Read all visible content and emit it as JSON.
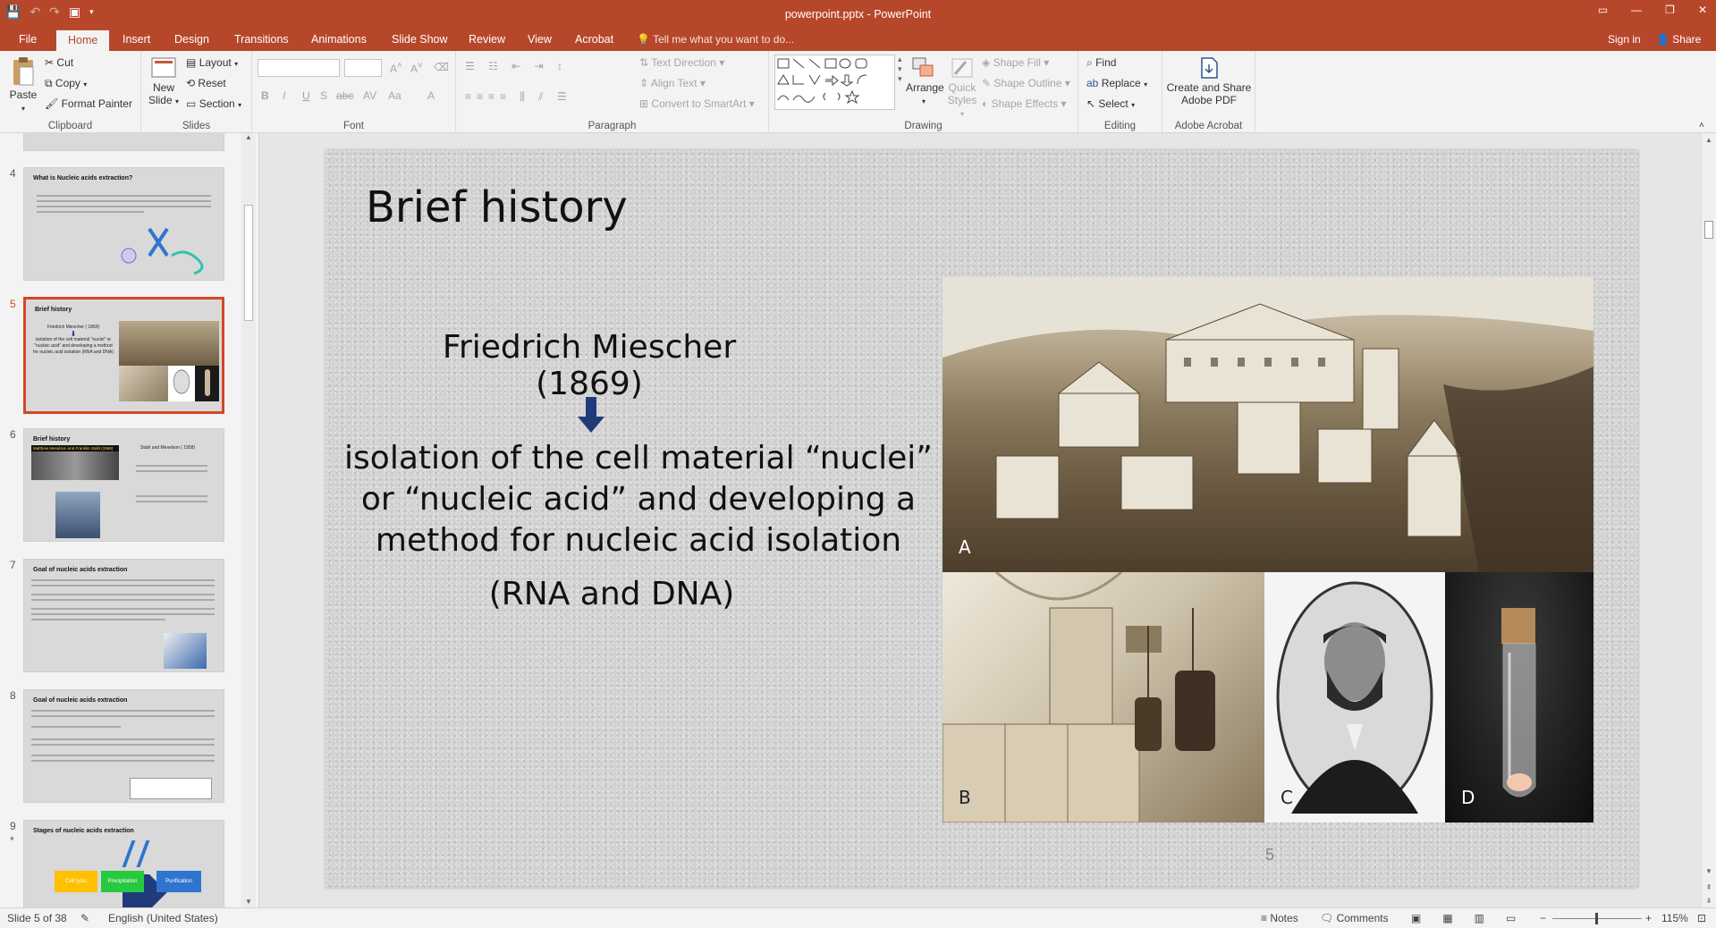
{
  "window": {
    "title": "powerpoint.pptx - PowerPoint",
    "controls": [
      "▭",
      "—",
      "❐",
      "✕"
    ]
  },
  "tabs": [
    "File",
    "Home",
    "Insert",
    "Design",
    "Transitions",
    "Animations",
    "Slide Show",
    "Review",
    "View",
    "Acrobat"
  ],
  "active_tab": "Home",
  "tell_me": "Tell me what you want to do...",
  "account": {
    "sign_in": "Sign in",
    "share": "Share"
  },
  "ribbon": {
    "clipboard": {
      "label": "Clipboard",
      "paste": "Paste",
      "cut": "Cut",
      "copy": "Copy",
      "format_painter": "Format Painter"
    },
    "slides": {
      "label": "Slides",
      "new_slide": "New Slide",
      "layout": "Layout",
      "reset": "Reset",
      "section": "Section"
    },
    "font": {
      "label": "Font",
      "bold": "B",
      "italic": "I",
      "underline": "U",
      "shadow": "S",
      "strike": "abc",
      "spacing": "AV",
      "case": "Aa",
      "color": "A"
    },
    "paragraph": {
      "label": "Paragraph",
      "text_direction": "Text Direction",
      "align_text": "Align Text",
      "smartart": "Convert to SmartArt"
    },
    "drawing": {
      "label": "Drawing",
      "arrange": "Arrange",
      "quick_styles": "Quick Styles",
      "shape_fill": "Shape Fill",
      "shape_outline": "Shape Outline",
      "shape_effects": "Shape Effects"
    },
    "editing": {
      "label": "Editing",
      "find": "Find",
      "replace": "Replace",
      "select": "Select"
    },
    "acrobat": {
      "label": "Adobe Acrobat",
      "create_pdf": "Create and Share Adobe PDF"
    }
  },
  "thumbnails": [
    {
      "num": "4",
      "title": "What is Nucleic acids extraction?"
    },
    {
      "num": "5",
      "title": "Brief history",
      "sub1": "Friedrich Miescher ( 1869)",
      "sub2": "isolation of the cell material \"nuclei\" or \"nucleic acid\" and developing a method for nucleic acid isolation (RNA and DNA)"
    },
    {
      "num": "6",
      "title": "Brief history",
      "sub1": "Matthew Meselson and Franklin Stahl (1958)",
      "sub2": "Stahl and Meselson ( 1958)"
    },
    {
      "num": "7",
      "title": "Goal of nucleic acids extraction"
    },
    {
      "num": "8",
      "title": "Goal of nucleic acids extraction"
    },
    {
      "num": "9",
      "title": "Stages of nucleic acids extraction",
      "star": "*",
      "labels": [
        "Cell lysis",
        "Precipitation",
        "Purification"
      ]
    }
  ],
  "slide": {
    "title": "Brief history",
    "person": "Friedrich Miescher (1869)",
    "description": "isolation of  the cell material “nuclei” or “nucleic acid” and developing a method for nucleic acid isolation",
    "rna_dna": "(RNA and DNA)",
    "photo_labels": [
      "A",
      "B",
      "C",
      "D"
    ],
    "page_number": "5",
    "arrow_color": "#1f3b7a"
  },
  "status": {
    "slide_info": "Slide 5 of 38",
    "language": "English (United States)",
    "notes": "Notes",
    "comments": "Comments",
    "zoom": "115%"
  },
  "colors": {
    "accent": "#b7472a",
    "selection": "#d24726"
  }
}
